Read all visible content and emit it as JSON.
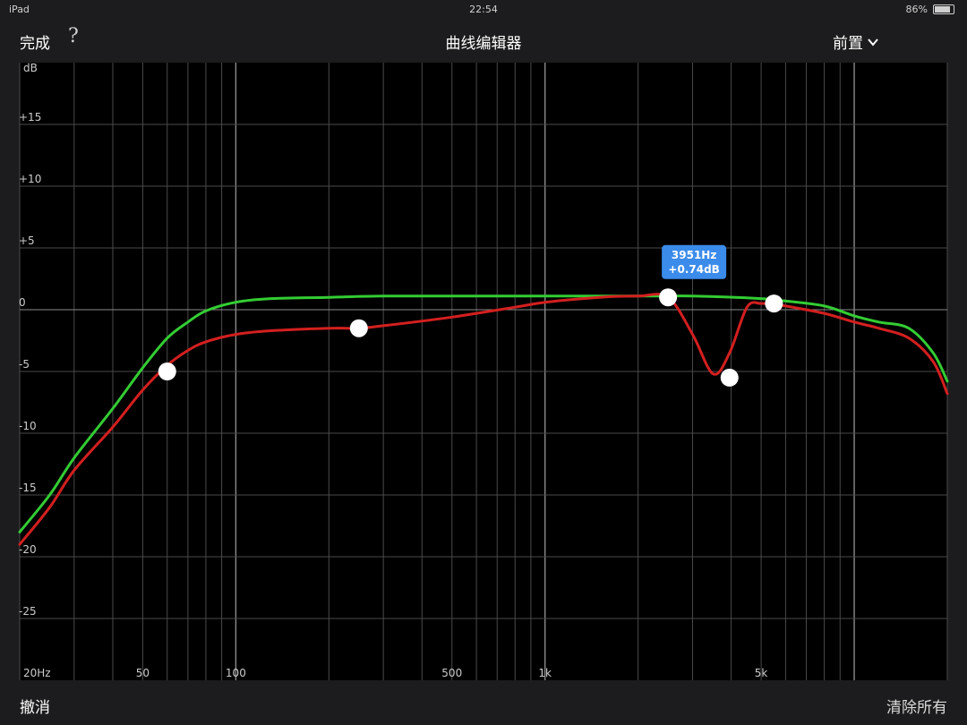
{
  "status_bar": {
    "device": "iPad",
    "time": "22:54",
    "battery": "86%",
    "battery_level": 0.86
  },
  "nav": {
    "done_label": "完成",
    "help_label": "?",
    "title": "曲线编辑器",
    "preset_label": "前置"
  },
  "bottom": {
    "undo_label": "撤消",
    "clear_label": "清除所有"
  },
  "colors": {
    "background": "#000000",
    "grid": "#4a4a4a",
    "grid_major": "#8a8a8a",
    "target_curve": "#33cc33",
    "measured_curve": "#d41f1f",
    "point": "#ffffff",
    "tooltip": "#3b8beb"
  },
  "tooltip": {
    "line1": "3951Hz",
    "line2": "+0.74dB"
  },
  "chart_data": {
    "type": "line",
    "x_scale": "log",
    "xlim": [
      20,
      20000
    ],
    "ylim": [
      -30,
      20
    ],
    "ylabel": "dB",
    "y_ticks": [
      {
        "value": 15,
        "label": "+15"
      },
      {
        "value": 10,
        "label": "+10"
      },
      {
        "value": 5,
        "label": "+5"
      },
      {
        "value": 0,
        "label": "0"
      },
      {
        "value": -5,
        "label": "-5"
      },
      {
        "value": -10,
        "label": "-10"
      },
      {
        "value": -15,
        "label": "-15"
      },
      {
        "value": -20,
        "label": "-20"
      },
      {
        "value": -25,
        "label": "-25"
      }
    ],
    "x_ticks": [
      {
        "value": 20,
        "label": "20Hz"
      },
      {
        "value": 50,
        "label": "50"
      },
      {
        "value": 100,
        "label": "100"
      },
      {
        "value": 500,
        "label": "500"
      },
      {
        "value": 1000,
        "label": "1k"
      },
      {
        "value": 5000,
        "label": "5k"
      }
    ],
    "series": [
      {
        "color": "#33cc33",
        "x": [
          20,
          25,
          30,
          40,
          50,
          60,
          70,
          80,
          100,
          130,
          200,
          300,
          500,
          1000,
          2000,
          3000,
          5000,
          6000,
          8000,
          10000,
          12000,
          15000,
          18000,
          20000
        ],
        "y": [
          -18.0,
          -15.0,
          -12.0,
          -8.0,
          -4.7,
          -2.3,
          -1.0,
          -0.1,
          0.6,
          0.9,
          1.0,
          1.1,
          1.1,
          1.1,
          1.1,
          1.1,
          0.9,
          0.7,
          0.3,
          -0.5,
          -1.0,
          -1.5,
          -3.5,
          -5.8
        ]
      },
      {
        "color": "#d41f1f",
        "x": [
          20,
          25,
          30,
          40,
          50,
          60,
          70,
          80,
          100,
          130,
          200,
          250,
          300,
          500,
          800,
          1000,
          1500,
          2000,
          2500,
          3000,
          3500,
          3951,
          4500,
          5000,
          5500,
          6000,
          8000,
          10000,
          12000,
          15000,
          18000,
          20000
        ],
        "y": [
          -19.0,
          -16.0,
          -13.0,
          -9.5,
          -6.5,
          -4.5,
          -3.3,
          -2.6,
          -2.0,
          -1.7,
          -1.5,
          -1.5,
          -1.3,
          -0.6,
          0.2,
          0.6,
          1.0,
          1.1,
          1.0,
          -2.0,
          -5.2,
          -3.5,
          0.2,
          0.5,
          0.4,
          0.3,
          -0.3,
          -1.0,
          -1.5,
          -2.3,
          -4.2,
          -6.8
        ]
      }
    ],
    "points": [
      {
        "x": 60,
        "y": -5.0
      },
      {
        "x": 250,
        "y": -1.5
      },
      {
        "x": 2500,
        "y": 1.0
      },
      {
        "x": 3951,
        "y": -5.5
      },
      {
        "x": 5500,
        "y": 0.5
      }
    ],
    "tooltip_point": {
      "x": 3951,
      "y": 0.74
    }
  }
}
